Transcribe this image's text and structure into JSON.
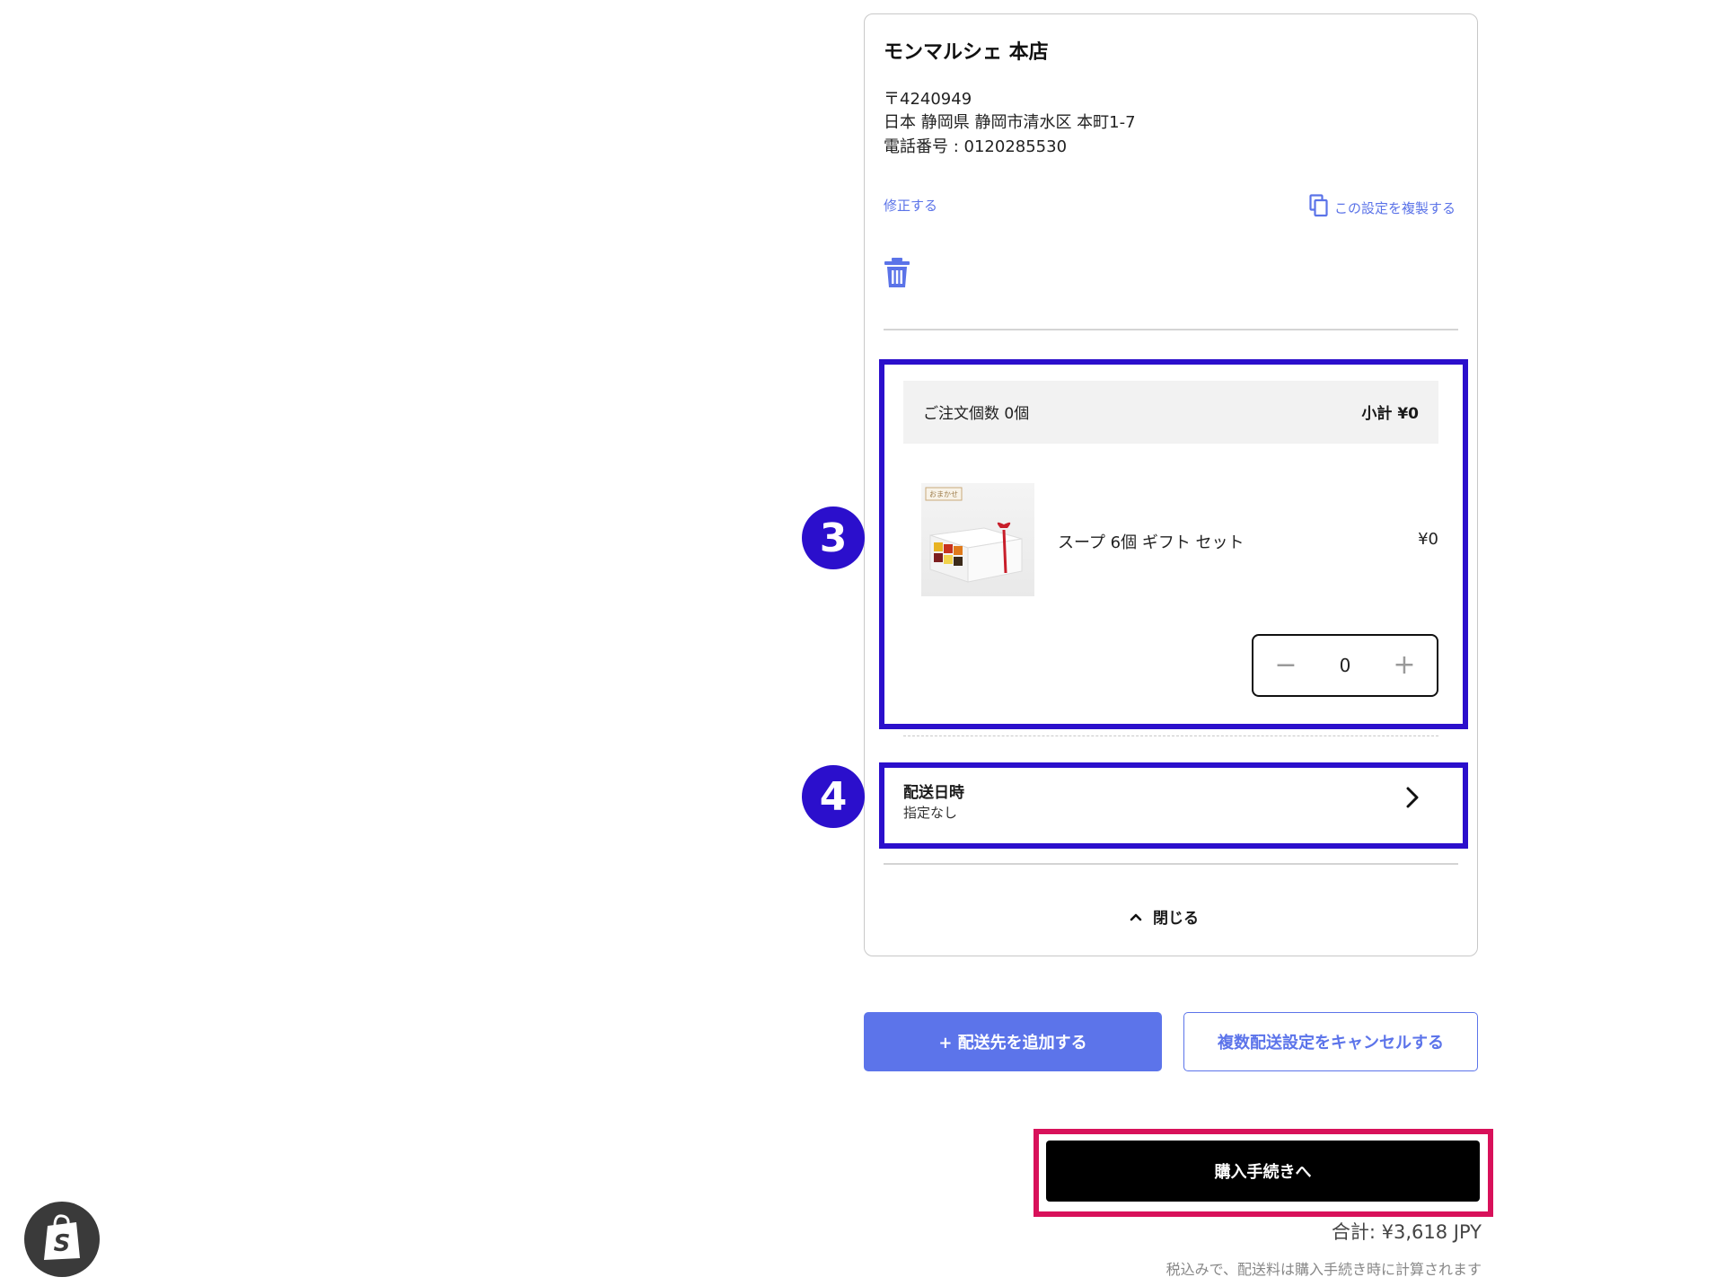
{
  "store": {
    "name": "モンマルシェ 本店",
    "postal": "〒4240949",
    "address": "日本 静岡県 静岡市清水区 本町1-7",
    "phone": "電話番号 : 0120285530",
    "edit_label": "修正する",
    "duplicate_label": "この設定を複製する"
  },
  "order": {
    "count_label": "ご注文個数 0個",
    "subtotal_label": "小計 ¥0",
    "product": {
      "name": "スープ 6個 ギフト セット",
      "price": "¥0",
      "quantity": "0",
      "image_tag": "おまかせ"
    }
  },
  "delivery": {
    "title": "配送日時",
    "value": "指定なし"
  },
  "close_label": "閉じる",
  "buttons": {
    "add_destination": "+ 配送先を追加する",
    "cancel_multi": "複数配送設定をキャンセルする",
    "checkout": "購入手続きへ"
  },
  "total_label": "合計: ¥3,618 JPY",
  "tax_note": "税込みで、配送料は購入手続き時に計算されます",
  "annotations": {
    "step3": "3",
    "step4": "4"
  },
  "colors": {
    "accent_blue": "#5c74ea",
    "highlight_blue": "#2b0fcc",
    "highlight_pink": "#d8115a"
  },
  "icons": [
    "copy-icon",
    "trash-icon",
    "minus-icon",
    "plus-icon",
    "chevron-right-icon",
    "chevron-up-icon",
    "shopify-bag-icon"
  ]
}
